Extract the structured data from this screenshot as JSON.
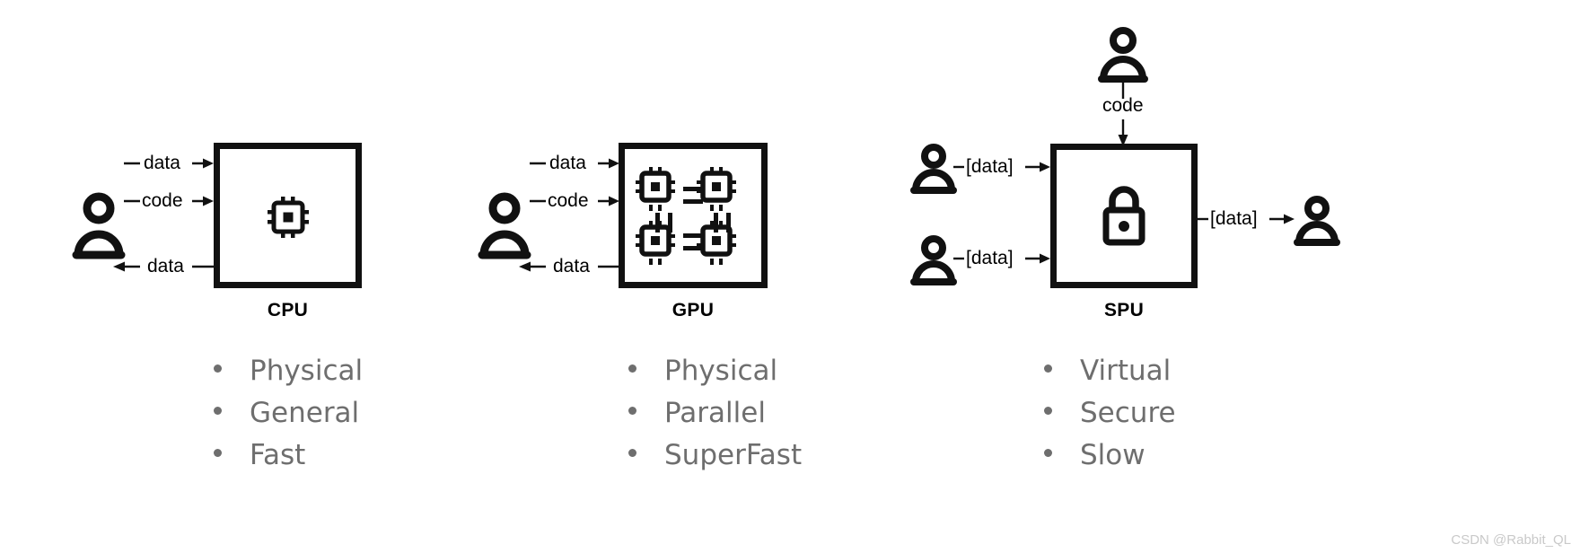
{
  "diagram": {
    "title_cpu": "CPU",
    "title_gpu": "GPU",
    "title_spu": "SPU",
    "colors": {
      "stroke": "#111111",
      "bullet_text": "#6e6e6e",
      "title_text": "#000000",
      "watermark": "#c9c9c9",
      "background": "#ffffff"
    }
  },
  "cpu": {
    "title": "CPU",
    "icon": "cpu-chip-icon",
    "actor_icon": "person-icon",
    "flows": [
      {
        "label": "data",
        "direction": "in"
      },
      {
        "label": "code",
        "direction": "in"
      },
      {
        "label": "data",
        "direction": "out"
      }
    ],
    "bullets": [
      "Physical",
      "General",
      "Fast"
    ]
  },
  "gpu": {
    "title": "GPU",
    "icon": "gpu-multichip-icon",
    "actor_icon": "person-icon",
    "flows": [
      {
        "label": "data",
        "direction": "in"
      },
      {
        "label": "code",
        "direction": "in"
      },
      {
        "label": "data",
        "direction": "out"
      }
    ],
    "bullets": [
      "Physical",
      "Parallel",
      "SuperFast"
    ]
  },
  "spu": {
    "title": "SPU",
    "icon": "lock-icon",
    "actor_icon": "person-icon",
    "flows": [
      {
        "label": "code",
        "direction": "in-top"
      },
      {
        "label": "[data]",
        "direction": "in"
      },
      {
        "label": "[data]",
        "direction": "in"
      },
      {
        "label": "[data]",
        "direction": "out"
      }
    ],
    "bullets": [
      "Virtual",
      "Secure",
      "Slow"
    ]
  },
  "watermark": "CSDN @Rabbit_QL"
}
